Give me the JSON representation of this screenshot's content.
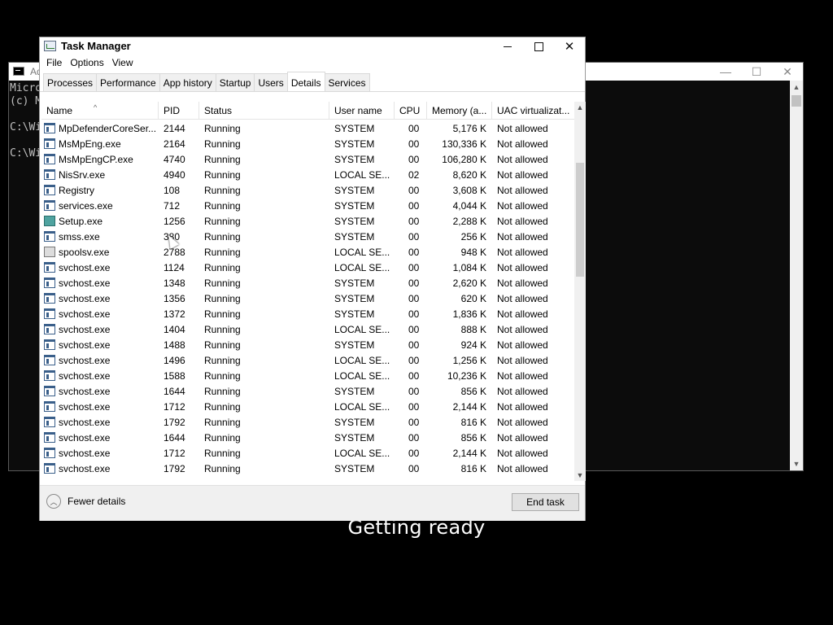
{
  "console": {
    "title": "Ad",
    "lines": [
      "Micro",
      "(c) M",
      "",
      "C:\\Wi",
      "",
      "C:\\Wi"
    ]
  },
  "overlay_text": "Getting ready",
  "taskmanager": {
    "title": "Task Manager",
    "menu": [
      "File",
      "Options",
      "View"
    ],
    "tabs": [
      "Processes",
      "Performance",
      "App history",
      "Startup",
      "Users",
      "Details",
      "Services"
    ],
    "active_tab": "Details",
    "columns": [
      "Name",
      "PID",
      "Status",
      "User name",
      "CPU",
      "Memory (a...",
      "UAC virtualizat..."
    ],
    "rows": [
      {
        "icon": "exe-icon",
        "name": "MpDefenderCoreSer...",
        "pid": "2144",
        "status": "Running",
        "user": "SYSTEM",
        "cpu": "00",
        "mem": "5,176 K",
        "uac": "Not allowed"
      },
      {
        "icon": "exe-icon",
        "name": "MsMpEng.exe",
        "pid": "2164",
        "status": "Running",
        "user": "SYSTEM",
        "cpu": "00",
        "mem": "130,336 K",
        "uac": "Not allowed"
      },
      {
        "icon": "exe-icon",
        "name": "MsMpEngCP.exe",
        "pid": "4740",
        "status": "Running",
        "user": "SYSTEM",
        "cpu": "00",
        "mem": "106,280 K",
        "uac": "Not allowed"
      },
      {
        "icon": "exe-icon",
        "name": "NisSrv.exe",
        "pid": "4940",
        "status": "Running",
        "user": "LOCAL SE...",
        "cpu": "02",
        "mem": "8,620 K",
        "uac": "Not allowed"
      },
      {
        "icon": "exe-icon",
        "name": "Registry",
        "pid": "108",
        "status": "Running",
        "user": "SYSTEM",
        "cpu": "00",
        "mem": "3,608 K",
        "uac": "Not allowed"
      },
      {
        "icon": "exe-icon",
        "name": "services.exe",
        "pid": "712",
        "status": "Running",
        "user": "SYSTEM",
        "cpu": "00",
        "mem": "4,044 K",
        "uac": "Not allowed"
      },
      {
        "icon": "setup-icon",
        "name": "Setup.exe",
        "pid": "1256",
        "status": "Running",
        "user": "SYSTEM",
        "cpu": "00",
        "mem": "2,288 K",
        "uac": "Not allowed"
      },
      {
        "icon": "exe-icon",
        "name": "smss.exe",
        "pid": "380",
        "status": "Running",
        "user": "SYSTEM",
        "cpu": "00",
        "mem": "256 K",
        "uac": "Not allowed"
      },
      {
        "icon": "printer-icon",
        "name": "spoolsv.exe",
        "pid": "2788",
        "status": "Running",
        "user": "LOCAL SE...",
        "cpu": "00",
        "mem": "948 K",
        "uac": "Not allowed"
      },
      {
        "icon": "exe-icon",
        "name": "svchost.exe",
        "pid": "1124",
        "status": "Running",
        "user": "LOCAL SE...",
        "cpu": "00",
        "mem": "1,084 K",
        "uac": "Not allowed"
      },
      {
        "icon": "exe-icon",
        "name": "svchost.exe",
        "pid": "1348",
        "status": "Running",
        "user": "SYSTEM",
        "cpu": "00",
        "mem": "2,620 K",
        "uac": "Not allowed"
      },
      {
        "icon": "exe-icon",
        "name": "svchost.exe",
        "pid": "1356",
        "status": "Running",
        "user": "SYSTEM",
        "cpu": "00",
        "mem": "620 K",
        "uac": "Not allowed"
      },
      {
        "icon": "exe-icon",
        "name": "svchost.exe",
        "pid": "1372",
        "status": "Running",
        "user": "SYSTEM",
        "cpu": "00",
        "mem": "1,836 K",
        "uac": "Not allowed"
      },
      {
        "icon": "exe-icon",
        "name": "svchost.exe",
        "pid": "1404",
        "status": "Running",
        "user": "LOCAL SE...",
        "cpu": "00",
        "mem": "888 K",
        "uac": "Not allowed"
      },
      {
        "icon": "exe-icon",
        "name": "svchost.exe",
        "pid": "1488",
        "status": "Running",
        "user": "SYSTEM",
        "cpu": "00",
        "mem": "924 K",
        "uac": "Not allowed"
      },
      {
        "icon": "exe-icon",
        "name": "svchost.exe",
        "pid": "1496",
        "status": "Running",
        "user": "LOCAL SE...",
        "cpu": "00",
        "mem": "1,256 K",
        "uac": "Not allowed"
      },
      {
        "icon": "exe-icon",
        "name": "svchost.exe",
        "pid": "1588",
        "status": "Running",
        "user": "LOCAL SE...",
        "cpu": "00",
        "mem": "10,236 K",
        "uac": "Not allowed"
      },
      {
        "icon": "exe-icon",
        "name": "svchost.exe",
        "pid": "1644",
        "status": "Running",
        "user": "SYSTEM",
        "cpu": "00",
        "mem": "856 K",
        "uac": "Not allowed"
      },
      {
        "icon": "exe-icon",
        "name": "svchost.exe",
        "pid": "1712",
        "status": "Running",
        "user": "LOCAL SE...",
        "cpu": "00",
        "mem": "2,144 K",
        "uac": "Not allowed"
      },
      {
        "icon": "exe-icon",
        "name": "svchost.exe",
        "pid": "1792",
        "status": "Running",
        "user": "SYSTEM",
        "cpu": "00",
        "mem": "816 K",
        "uac": "Not allowed"
      },
      {
        "icon": "exe-icon",
        "name": "svchost.exe",
        "pid": "1644",
        "status": "Running",
        "user": "SYSTEM",
        "cpu": "00",
        "mem": "856 K",
        "uac": "Not allowed"
      },
      {
        "icon": "exe-icon",
        "name": "svchost.exe",
        "pid": "1712",
        "status": "Running",
        "user": "LOCAL SE...",
        "cpu": "00",
        "mem": "2,144 K",
        "uac": "Not allowed"
      },
      {
        "icon": "exe-icon",
        "name": "svchost.exe",
        "pid": "1792",
        "status": "Running",
        "user": "SYSTEM",
        "cpu": "00",
        "mem": "816 K",
        "uac": "Not allowed"
      }
    ],
    "footer": {
      "fewer_details": "Fewer details",
      "end_task": "End task"
    }
  }
}
